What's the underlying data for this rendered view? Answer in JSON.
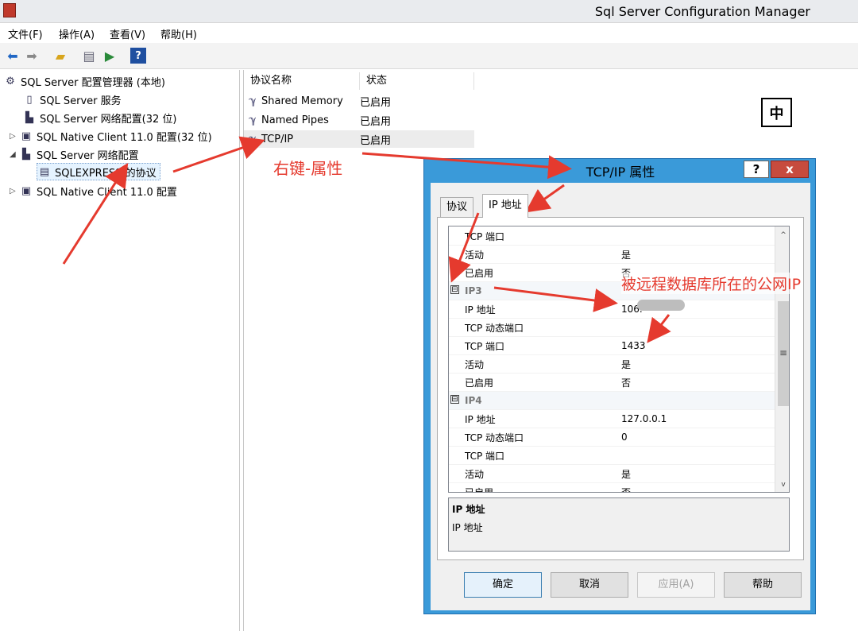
{
  "window": {
    "title": "Sql Server Configuration Manager"
  },
  "menu": [
    "文件(F)",
    "操作(A)",
    "查看(V)",
    "帮助(H)"
  ],
  "toolbar": [
    "back-arrow-icon",
    "forward-arrow-icon",
    "folder-up-icon",
    "properties-icon",
    "export-icon",
    "help-icon"
  ],
  "tree": {
    "root": "SQL Server 配置管理器 (本地)",
    "items": [
      {
        "label": "SQL Server 服务",
        "icon": "server-service-icon"
      },
      {
        "label": "SQL Server 网络配置(32 位)",
        "icon": "network-config-icon"
      },
      {
        "label": "SQL Native Client 11.0 配置(32 位)",
        "icon": "native-client-icon",
        "expander": "▷"
      },
      {
        "label": "SQL Server 网络配置",
        "icon": "network-config-icon",
        "expander": "◢"
      },
      {
        "label": "SQLEXPRESS 的协议",
        "icon": "protocol-icon"
      },
      {
        "label": "SQL Native Client 11.0 配置",
        "icon": "native-client-icon",
        "expander": "▷"
      }
    ]
  },
  "list": {
    "columns": [
      "协议名称",
      "状态"
    ],
    "rows": [
      {
        "name": "Shared Memory",
        "status": "已启用"
      },
      {
        "name": "Named Pipes",
        "status": "已启用"
      },
      {
        "name": "TCP/IP",
        "status": "已启用"
      }
    ]
  },
  "ime": "中",
  "dialog": {
    "title": "TCP/IP 属性",
    "help": "?",
    "close": "x",
    "tabs": [
      "协议",
      "IP 地址"
    ],
    "rows": [
      {
        "key": "TCP 端口",
        "value": ""
      },
      {
        "key": "活动",
        "value": "是"
      },
      {
        "key": "已启用",
        "value": "否"
      },
      {
        "category": "IP3",
        "box": "⊟"
      },
      {
        "key": "IP 地址",
        "value": "106."
      },
      {
        "key": "TCP 动态端口",
        "value": ""
      },
      {
        "key": "TCP 端口",
        "value": "1433"
      },
      {
        "key": "活动",
        "value": "是"
      },
      {
        "key": "已启用",
        "value": "否"
      },
      {
        "category": "IP4",
        "box": "⊟"
      },
      {
        "key": "IP 地址",
        "value": "127.0.0.1"
      },
      {
        "key": "TCP 动态端口",
        "value": "0"
      },
      {
        "key": "TCP 端口",
        "value": ""
      },
      {
        "key": "活动",
        "value": "是"
      },
      {
        "key": "已启用",
        "value": "否"
      }
    ],
    "scroll_up": "^",
    "scroll_grip": "≡",
    "scroll_down": "v",
    "desc_title": "IP 地址",
    "desc_text": "IP 地址",
    "buttons": {
      "ok": "确定",
      "cancel": "取消",
      "apply": "应用(A)",
      "help": "帮助"
    }
  },
  "annotations": {
    "right_click": "右键-属性",
    "public_ip": "被远程数据库所在的公网IP"
  },
  "colors": {
    "annotation": "#e53a2e",
    "dialog_frame": "#3a9ad9",
    "close_button": "#c74b3e"
  }
}
